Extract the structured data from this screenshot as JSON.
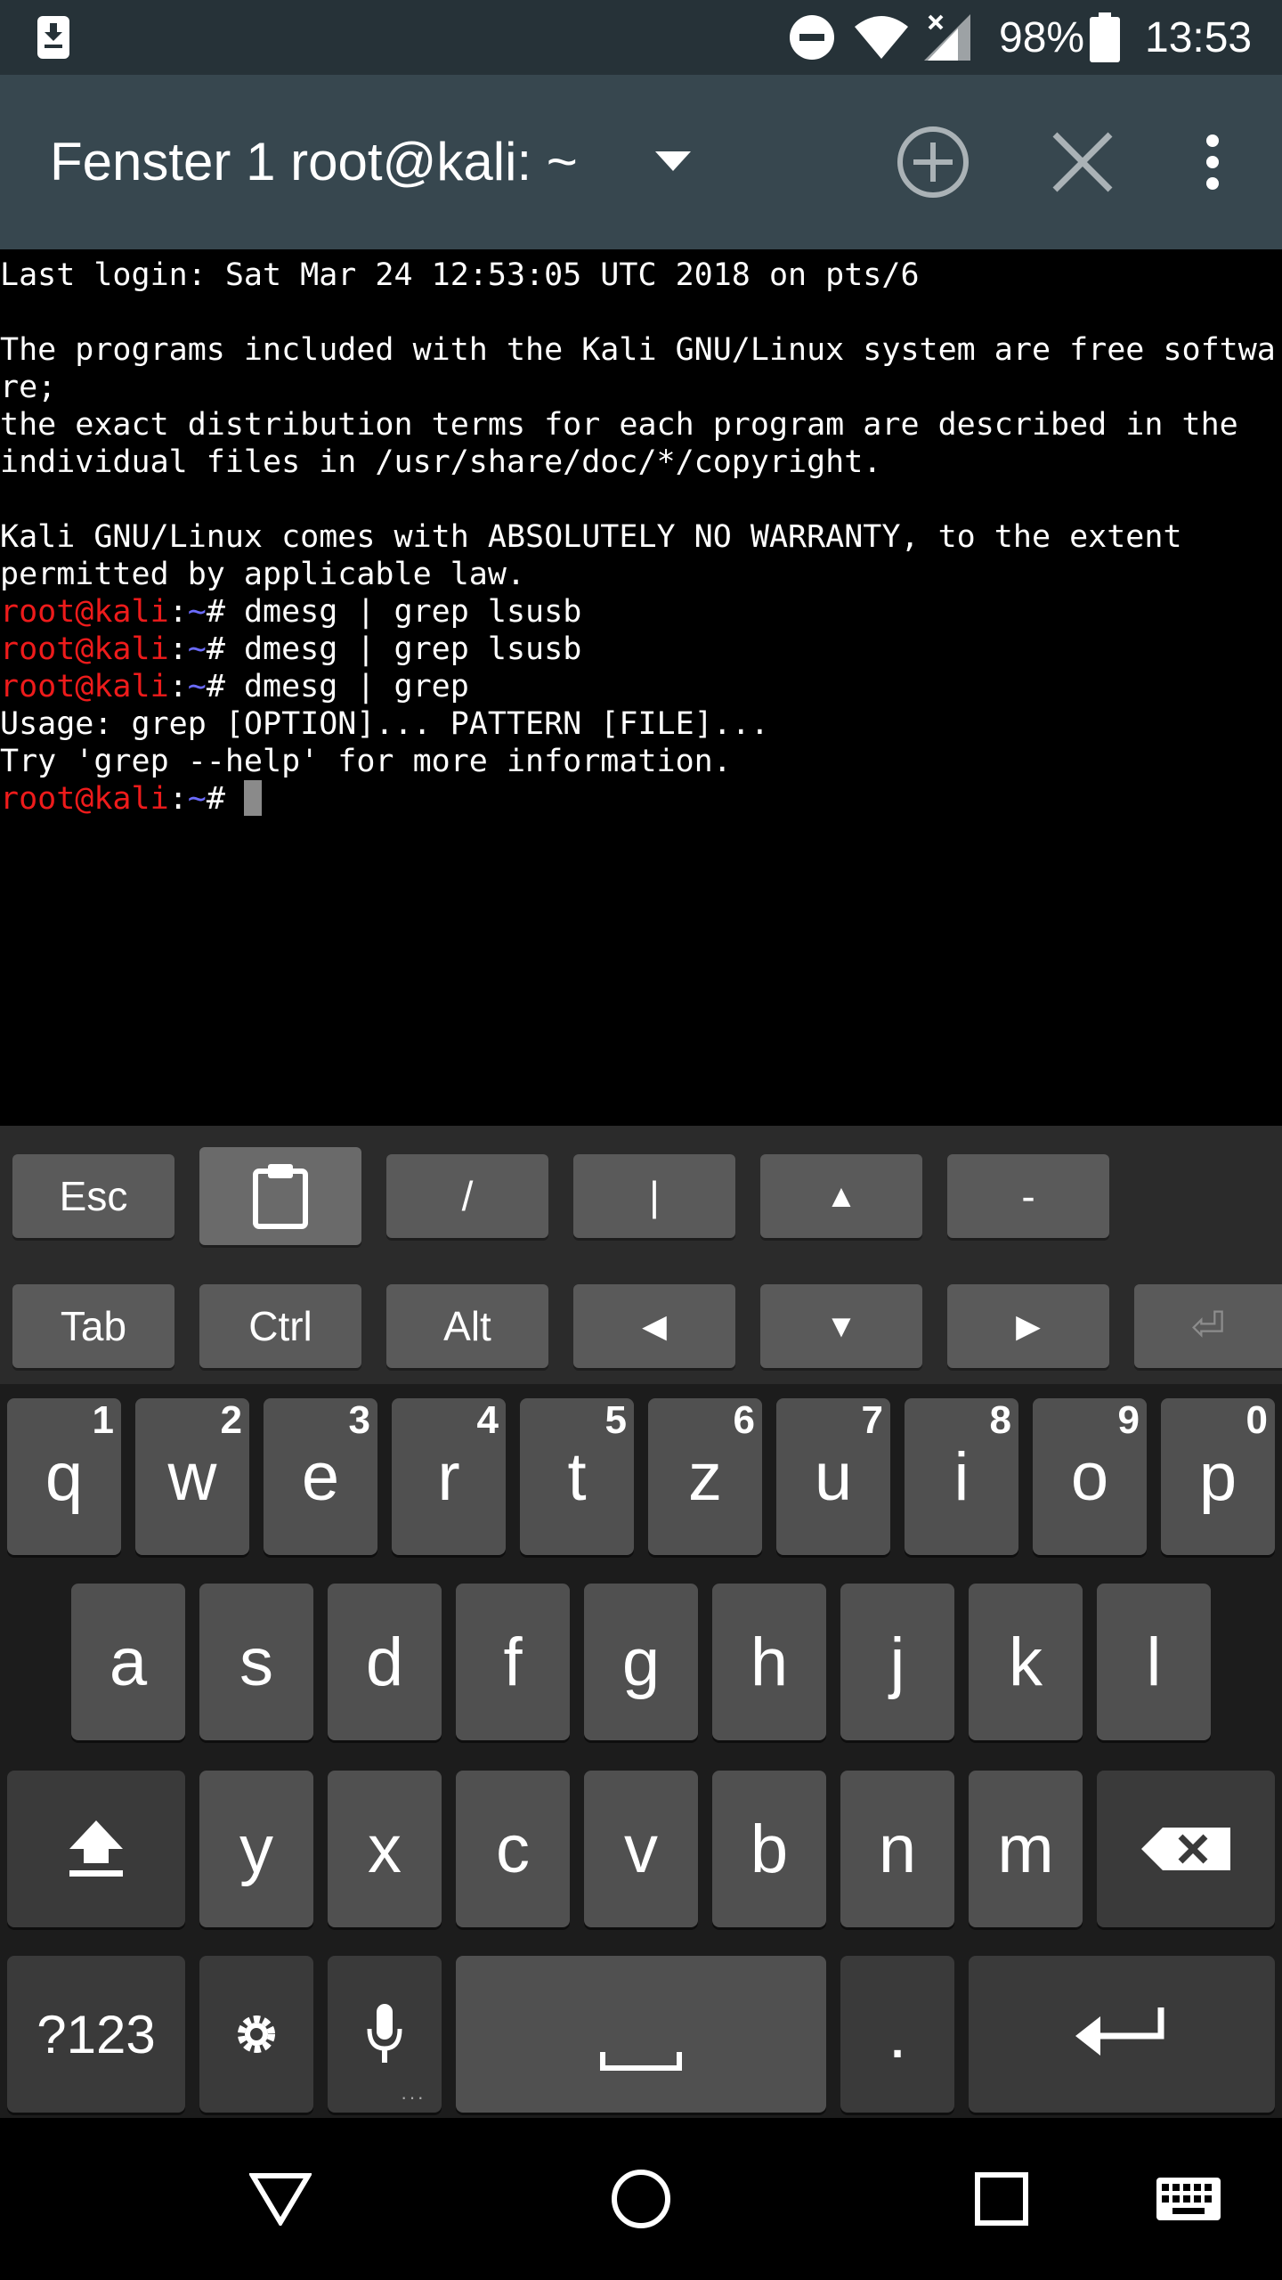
{
  "status_bar": {
    "battery_percent": "98%",
    "time": "13:53",
    "icons": [
      "download-icon",
      "do-not-disturb-icon",
      "wifi-icon",
      "signal-icon",
      "battery-icon"
    ]
  },
  "toolbar": {
    "window_title": "Fenster 1 root@kali: ~",
    "icons": [
      "chevron-down-icon",
      "add-circle-icon",
      "close-icon",
      "more-vert-icon"
    ]
  },
  "terminal": {
    "lines": [
      "Last login: Sat Mar 24 12:53:05 UTC 2018 on pts/6",
      "",
      "The programs included with the Kali GNU/Linux system are free softwa",
      "re;",
      "the exact distribution terms for each program are described in the",
      "individual files in /usr/share/doc/*/copyright.",
      "",
      "Kali GNU/Linux comes with ABSOLUTELY NO WARRANTY, to the extent",
      "permitted by applicable law."
    ],
    "prompt_user": "root@kali",
    "prompt_sep": ":",
    "prompt_path": "~",
    "prompt_symbol": "# ",
    "commands": [
      "dmesg | grep lsusb",
      "dmesg | grep lsusb",
      "dmesg | grep"
    ],
    "output": [
      "Usage: grep [OPTION]... PATTERN [FILE]...",
      "Try 'grep --help' for more information."
    ],
    "colors": {
      "user": "#ee1b1b",
      "path": "#6b6bff",
      "text": "#ffffff"
    }
  },
  "extra_keys": {
    "row1": [
      "Esc",
      "clipboard",
      "/",
      "|",
      "▲",
      "-"
    ],
    "row2": [
      "Tab",
      "Ctrl",
      "Alt",
      "◀",
      "▼",
      "▶",
      "⏎"
    ]
  },
  "keyboard": {
    "row1": [
      {
        "label": "q",
        "hint": "1"
      },
      {
        "label": "w",
        "hint": "2"
      },
      {
        "label": "e",
        "hint": "3"
      },
      {
        "label": "r",
        "hint": "4"
      },
      {
        "label": "t",
        "hint": "5"
      },
      {
        "label": "z",
        "hint": "6"
      },
      {
        "label": "u",
        "hint": "7"
      },
      {
        "label": "i",
        "hint": "8"
      },
      {
        "label": "o",
        "hint": "9"
      },
      {
        "label": "p",
        "hint": "0"
      }
    ],
    "row2": [
      "a",
      "s",
      "d",
      "f",
      "g",
      "h",
      "j",
      "k",
      "l"
    ],
    "row3": [
      "y",
      "x",
      "c",
      "v",
      "b",
      "n",
      "m"
    ],
    "symbols_label": "?123",
    "period_label": "."
  },
  "nav_bar": {
    "icons": [
      "back-triangle-icon",
      "home-circle-icon",
      "recents-square-icon",
      "keyboard-icon"
    ]
  }
}
